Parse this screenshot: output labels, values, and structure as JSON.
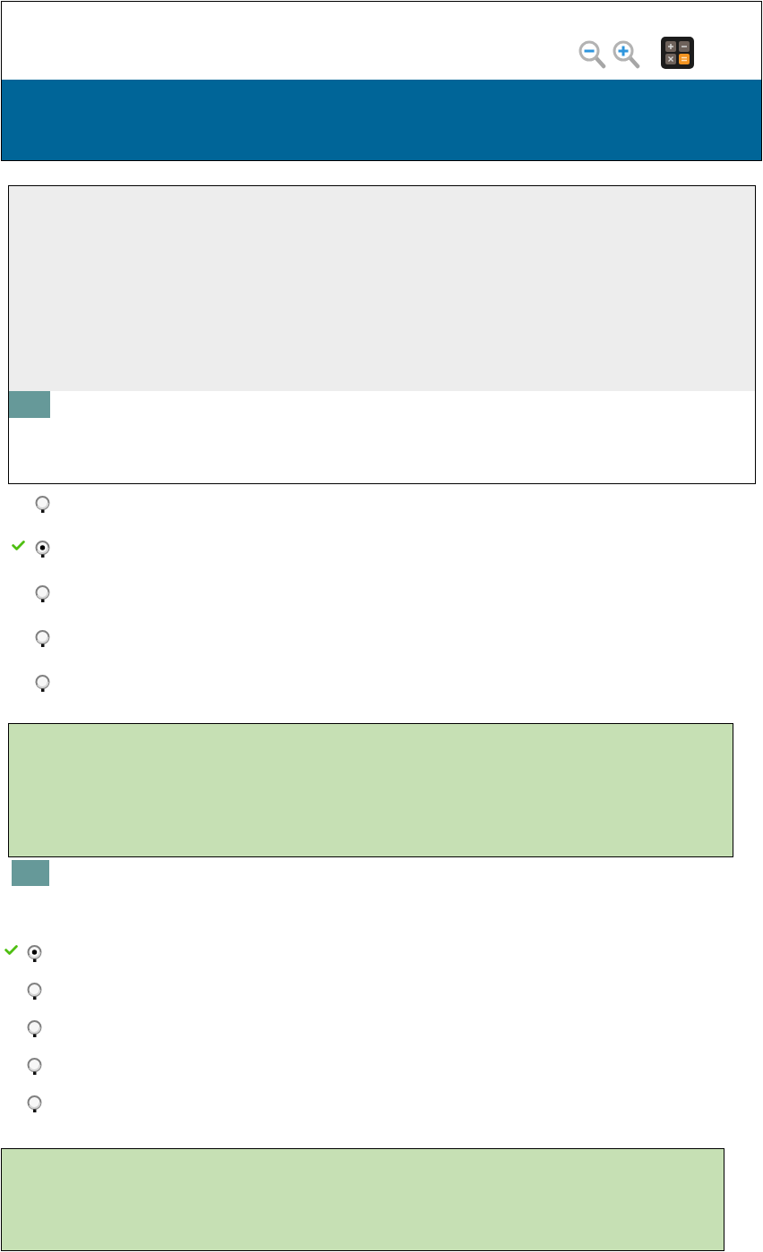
{
  "toolbar": {
    "tools": [
      {
        "kind": "zoom-out"
      },
      {
        "kind": "zoom-in"
      },
      {
        "kind": "calculator"
      }
    ]
  },
  "questions": [
    {
      "kind": "passage",
      "options": [
        {
          "selected": false,
          "correct": false
        },
        {
          "selected": true,
          "correct": true
        },
        {
          "selected": false,
          "correct": false
        },
        {
          "selected": false,
          "correct": false
        },
        {
          "selected": false,
          "correct": false
        }
      ],
      "feedback_shown": true
    },
    {
      "kind": "plain",
      "options": [
        {
          "selected": true,
          "correct": true
        },
        {
          "selected": false,
          "correct": false
        },
        {
          "selected": false,
          "correct": false
        },
        {
          "selected": false,
          "correct": false
        },
        {
          "selected": false,
          "correct": false
        }
      ],
      "feedback_shown": true
    }
  ]
}
